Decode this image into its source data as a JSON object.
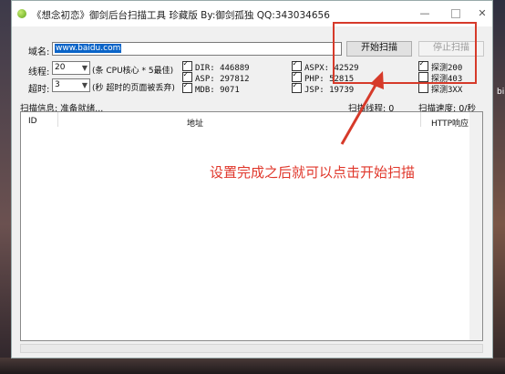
{
  "window": {
    "title": "《想念初恋》御剑后台扫描工具 珍藏版 By:御剑孤独 QQ:343034656",
    "minimize": "—",
    "close": "✕"
  },
  "form": {
    "domain_label": "域名:",
    "domain_value": "www.baidu.com",
    "threads_label": "线程:",
    "threads_value": "20",
    "threads_hint": "(条 CPU核心 * 5最佳)",
    "timeout_label": "超时:",
    "timeout_value": "3",
    "timeout_hint": "(秒 超时的页面被丢弃)"
  },
  "buttons": {
    "start": "开始扫描",
    "stop": "停止扫描"
  },
  "checkboxes": [
    {
      "label": "DIR: 446889",
      "checked": true
    },
    {
      "label": "ASP: 297812",
      "checked": true
    },
    {
      "label": "MDB: 9071",
      "checked": true
    },
    {
      "label": "ASPX: 42529",
      "checked": true
    },
    {
      "label": "PHP: 52815",
      "checked": true
    },
    {
      "label": "JSP: 19739",
      "checked": true
    },
    {
      "label": "探测200",
      "checked": true
    },
    {
      "label": "探测403",
      "checked": false
    },
    {
      "label": "探测3XX",
      "checked": false
    }
  ],
  "status": {
    "info": "扫描信息: 准备就绪...",
    "threads": "扫描线程: 0",
    "speed": "扫描速度: 0/秒"
  },
  "table": {
    "columns": [
      "ID",
      "地址",
      "HTTP响应"
    ]
  },
  "annotation": {
    "text": "设置完成之后就可以点击开始扫描",
    "color": "#e0372b"
  },
  "background_text": "bi"
}
